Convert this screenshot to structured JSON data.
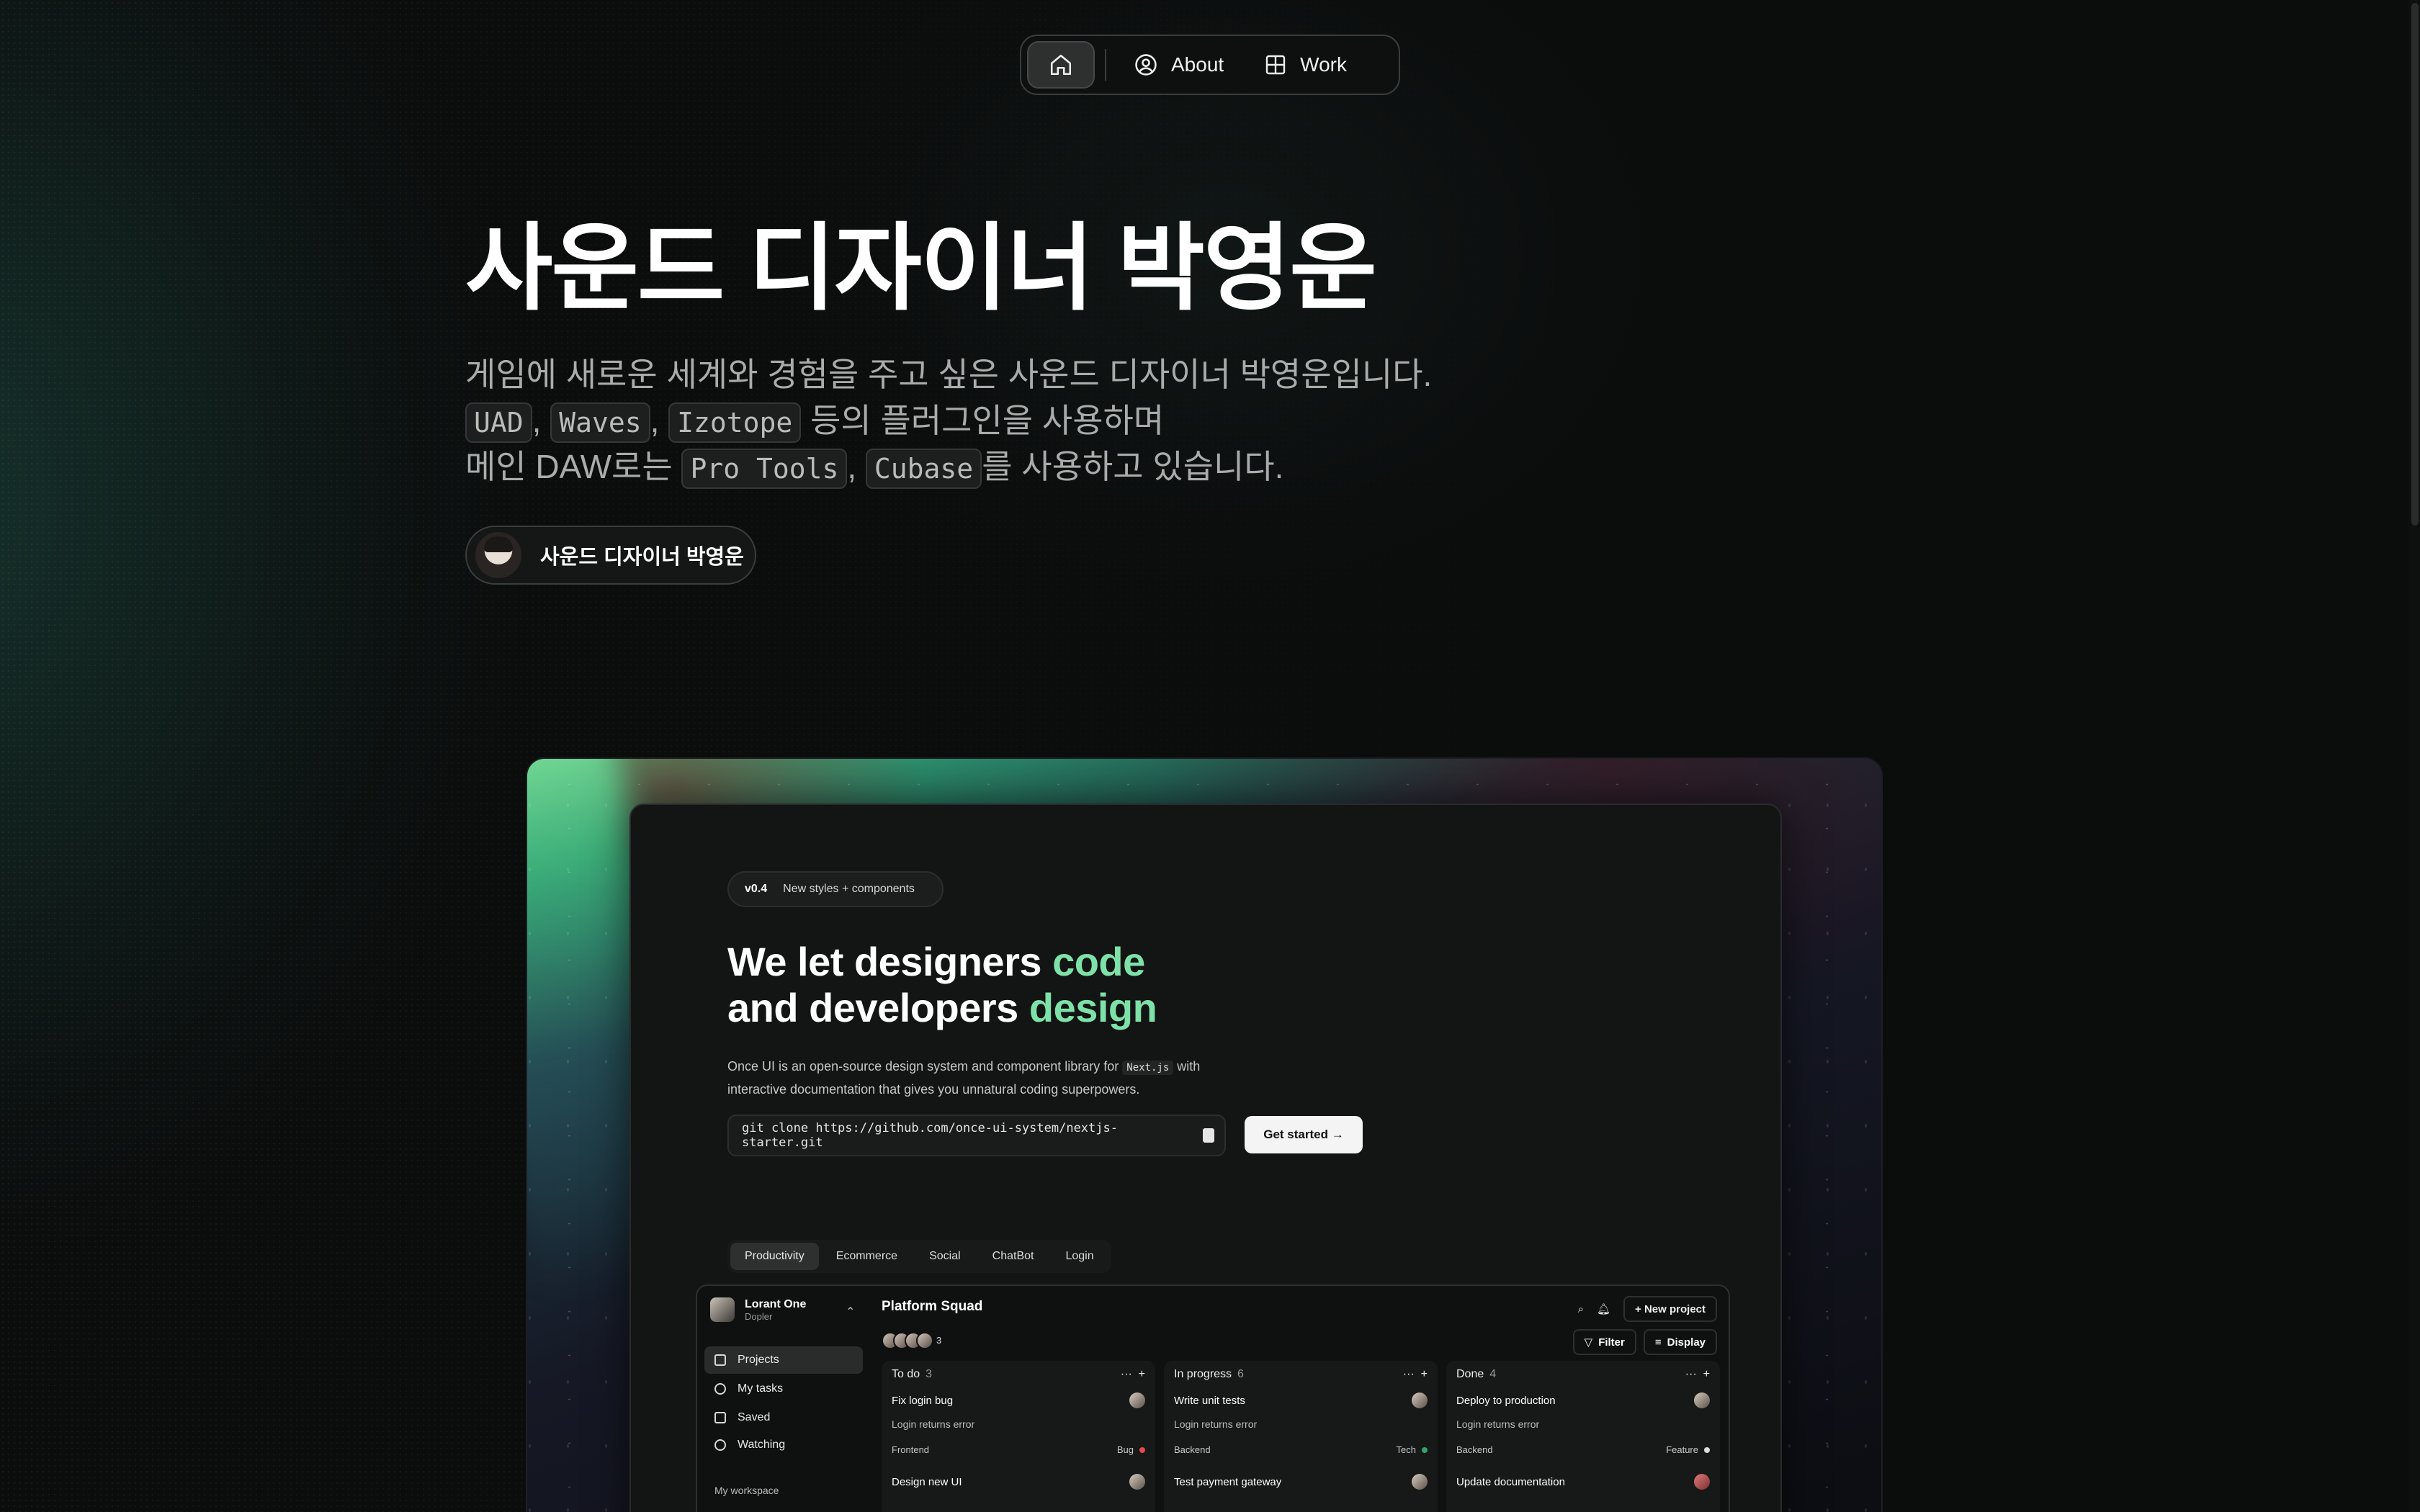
{
  "nav": {
    "home_icon": "home-icon",
    "items": [
      {
        "label": "About",
        "icon": "person-circle-icon"
      },
      {
        "label": "Work",
        "icon": "grid-icon"
      }
    ]
  },
  "hero": {
    "title": "사운드 디자이너 박영운",
    "line1": "게임에 새로운 세계와 경험을 주고 싶은 사운드 디자이너 박영운입니다.",
    "plugins": [
      "UAD",
      "Waves",
      "Izotope"
    ],
    "line2_suffix": " 등의 플러그인을 사용하며",
    "line3_prefix": "메인 DAW로는 ",
    "daws": [
      "Pro Tools",
      "Cubase"
    ],
    "line3_suffix": "를 사용하고 있습니다.",
    "comma": ", ",
    "author_label": "사운드 디자이너 박영운"
  },
  "showcase": {
    "version": "v0.4",
    "version_note": "New styles + components",
    "headline_a": "We let designers ",
    "headline_a_accent": "code",
    "headline_b": "and developers ",
    "headline_b_accent": "design",
    "desc_a": "Once UI is an open-source design system and component library for ",
    "desc_chip": "Next.js",
    "desc_b": " with",
    "desc_c": "interactive documentation that gives you unnatural coding superpowers.",
    "clone_cmd": "git clone https://github.com/once-ui-system/nextjs-starter.git",
    "get_started": "Get started →",
    "tabs": [
      "Productivity",
      "Ecommerce",
      "Social",
      "ChatBot",
      "Login"
    ],
    "app": {
      "org_name": "Lorant One",
      "org_sub": "Dopler",
      "sidebar": [
        "Projects",
        "My tasks",
        "Saved",
        "Watching"
      ],
      "workspace": "My workspace",
      "board_title": "Platform Squad",
      "avatar_count": "3",
      "new_project": "+ New project",
      "filter": "Filter",
      "display": "Display",
      "columns": [
        {
          "name": "To do",
          "count": "3",
          "card": {
            "title": "Fix login bug",
            "sub": "Login returns error",
            "tag": "Frontend",
            "label": "Bug",
            "color": "#e5484d"
          },
          "next": "Design new UI"
        },
        {
          "name": "In progress",
          "count": "6",
          "card": {
            "title": "Write unit tests",
            "sub": "Login returns error",
            "tag": "Backend",
            "label": "Tech",
            "color": "#30a46c"
          },
          "next": "Test payment gateway"
        },
        {
          "name": "Done",
          "count": "4",
          "card": {
            "title": "Deploy to production",
            "sub": "Login returns error",
            "tag": "Backend",
            "label": "Feature",
            "color": "#dddddd"
          },
          "next": "Update documentation"
        }
      ]
    }
  }
}
